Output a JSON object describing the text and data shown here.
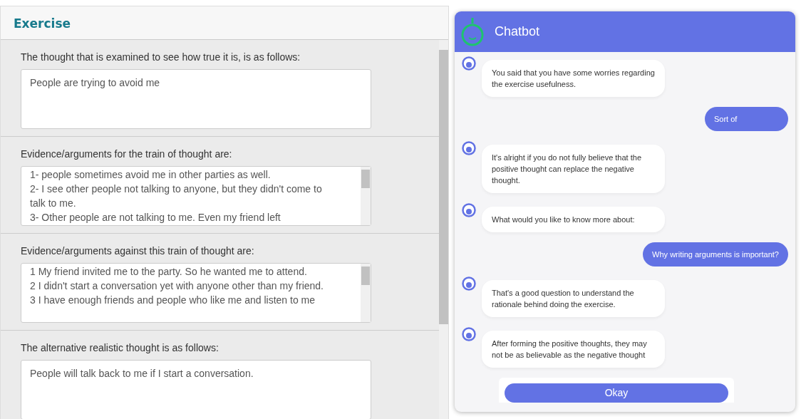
{
  "exercise": {
    "title": "Exercise",
    "questions": [
      {
        "label": "The thought that is examined to see how true it is, is as follows:",
        "lines": [
          "People are trying to avoid me"
        ],
        "scrollable": false
      },
      {
        "label": "Evidence/arguments for the train of thought are:",
        "lines": [
          "1- people sometimes avoid me in other parties as well.",
          "2- I see other people not talking to anyone, but they didn't come to",
          "talk to me.",
          "3- Other people are not talking to me. Even my friend left"
        ],
        "scrollable": true
      },
      {
        "label": "Evidence/arguments against this train of thought are:",
        "lines": [
          "1  My friend invited me to the party. So he wanted me to attend.",
          "2  I didn't start a conversation yet with anyone other than my friend.",
          "3  I have enough friends and people who like me and listen to me"
        ],
        "scrollable": true
      },
      {
        "label": "The alternative realistic thought is as follows:",
        "lines": [
          "People will talk back to me if I start a conversation."
        ],
        "scrollable": false
      }
    ]
  },
  "chatbot": {
    "title": "Chatbot",
    "messages": [
      {
        "kind": "bot",
        "text": "You said that you have some worries regarding the exercise usefulness."
      },
      {
        "kind": "user",
        "text": "Sort of"
      },
      {
        "kind": "bot",
        "text": "It's alright if you do not fully believe that the positive thought can replace the negative thought."
      },
      {
        "kind": "bot",
        "text": "What would you like to know more about:"
      },
      {
        "kind": "user",
        "text": "Why writing arguments is important?"
      },
      {
        "kind": "bot",
        "text": "That's a good question to understand the rationale behind doing the exercise."
      },
      {
        "kind": "bot",
        "text": "After forming the positive thoughts, they may not be as believable as the negative thought"
      }
    ],
    "action_button": "Okay"
  }
}
